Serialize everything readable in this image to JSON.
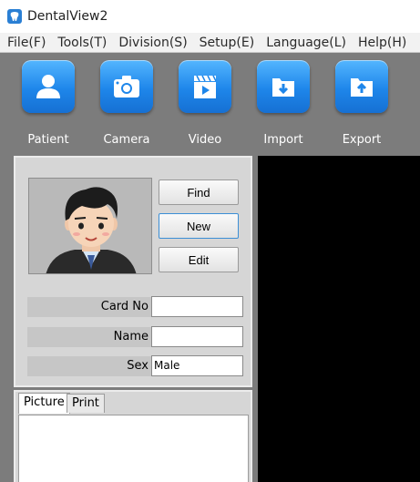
{
  "window": {
    "title": "DentalView2"
  },
  "menu": [
    "File(F)",
    "Tools(T)",
    "Division(S)",
    "Setup(E)",
    "Language(L)",
    "Help(H)"
  ],
  "toolbar": {
    "patient": "Patient",
    "camera": "Camera",
    "video": "Video",
    "import": "Import",
    "export": "Export"
  },
  "patient_panel": {
    "find": "Find",
    "new": "New",
    "edit": "Edit",
    "card_no_label": "Card No",
    "card_no_value": "",
    "name_label": "Name",
    "name_value": "",
    "sex_label": "Sex",
    "sex_value": "Male"
  },
  "tabs": [
    "Picture",
    "Print"
  ],
  "colors": {
    "toolbar_bg": "#7c7c7c",
    "accent": "#1e86ea",
    "viewer_bg": "#000000"
  }
}
